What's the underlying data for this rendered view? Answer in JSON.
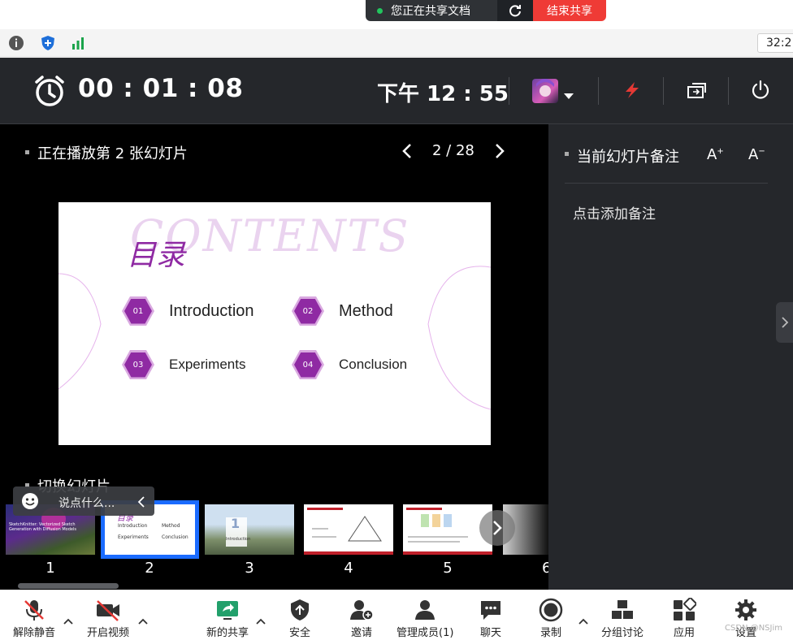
{
  "share_banner": {
    "status_text": "您正在共享文档",
    "stop_label": "结束共享"
  },
  "browser": {
    "clock_text": "32:2"
  },
  "presenter": {
    "timer": "00 : 01 : 08",
    "current_time": "下午 12 : 55",
    "playing_label": "正在播放第 2 张幻灯片",
    "page_counter": "2 / 28",
    "notes_title": "当前幻灯片备注",
    "font_increase": "A",
    "font_decrease": "A",
    "notes_placeholder": "点击添加备注",
    "switch_label": "切换幻灯片",
    "chat_placeholder": "说点什么...",
    "slide": {
      "bg_word": "CONTENTS",
      "title": "目录",
      "items": [
        {
          "num": "01",
          "label": "Introduction"
        },
        {
          "num": "02",
          "label": "Method"
        },
        {
          "num": "03",
          "label": "Experiments"
        },
        {
          "num": "04",
          "label": "Conclusion"
        }
      ]
    },
    "thumbnails": [
      {
        "number": "1"
      },
      {
        "number": "2"
      },
      {
        "number": "3"
      },
      {
        "number": "4"
      },
      {
        "number": "5"
      },
      {
        "number": "6"
      }
    ],
    "thumb_text": {
      "t1_title": "SketchKnitter: Vectorized Sketch Generation with Diffusion Models",
      "t2_items": [
        "Introduction",
        "Method",
        "Experiments",
        "Conclusion"
      ],
      "t3_number": "1",
      "t3_label": "Introduction"
    }
  },
  "toolbar": {
    "unmute": "解除静音",
    "start_video": "开启视频",
    "new_share": "新的共享",
    "security": "安全",
    "invite": "邀请",
    "manage_members": "管理成员(1)",
    "chat": "聊天",
    "record": "录制",
    "breakout": "分组讨论",
    "apps": "应用",
    "settings": "设置",
    "watermark": "CSDN @NSJim"
  },
  "colors": {
    "stop_red": "#ef3b36",
    "slide_purple": "#8f2aa3",
    "thumb_highlight": "#1a6bff",
    "presenter_bg": "#25272b"
  }
}
